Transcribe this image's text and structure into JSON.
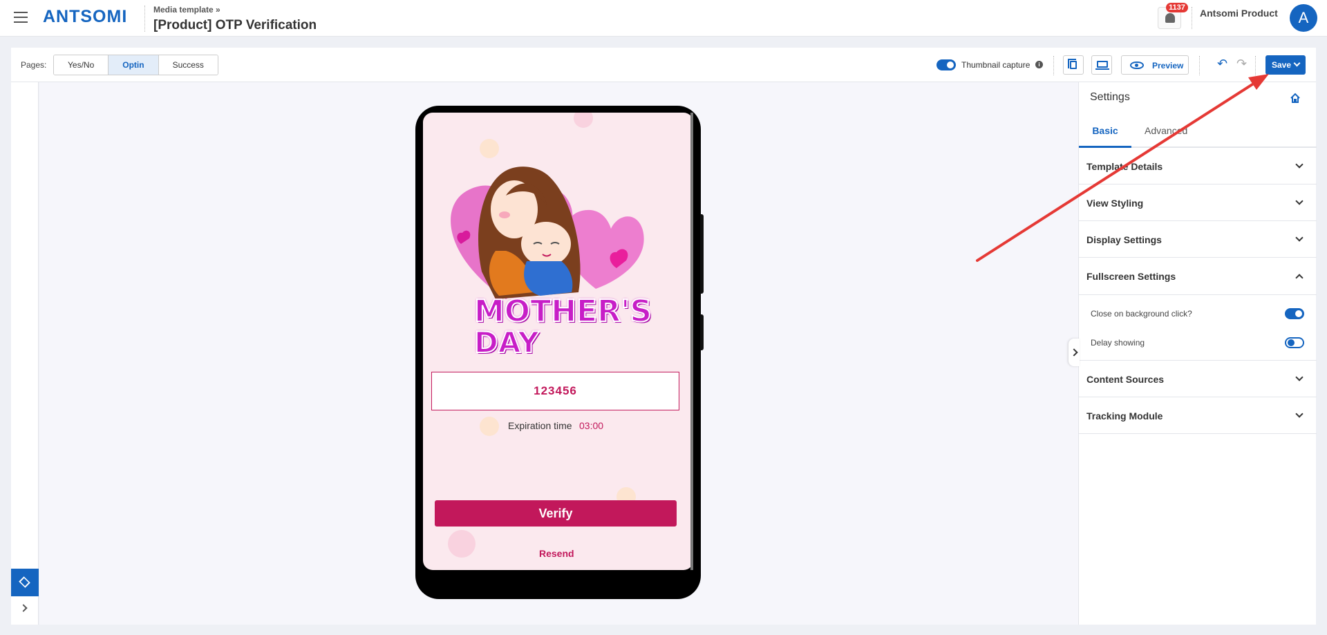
{
  "header": {
    "logo": "ANTSOMI",
    "breadcrumb": "Media template »",
    "title": "[Product] OTP Verification",
    "notification_count": "1137",
    "account_name": "Antsomi Product",
    "avatar_initial": "A"
  },
  "toolbar": {
    "pages_label": "Pages:",
    "pages": [
      {
        "label": "Yes/No",
        "active": false
      },
      {
        "label": "Optin",
        "active": true
      },
      {
        "label": "Success",
        "active": false
      }
    ],
    "thumbnail_capture_label": "Thumbnail capture",
    "thumbnail_capture_on": true,
    "preview_label": "Preview",
    "save_label": "Save"
  },
  "canvas": {
    "hero_line1": "MOTHER'S",
    "hero_line2": "DAY",
    "otp_value": "123456",
    "expiration_label": "Expiration time",
    "expiration_time": "03:00",
    "verify_label": "Verify",
    "resend_label": "Resend"
  },
  "settings": {
    "title": "Settings",
    "tabs": [
      {
        "label": "Basic",
        "active": true
      },
      {
        "label": "Advanced",
        "active": false
      }
    ],
    "sections": [
      {
        "label": "Template Details",
        "expanded": false
      },
      {
        "label": "View Styling",
        "expanded": false
      },
      {
        "label": "Display Settings",
        "expanded": false
      },
      {
        "label": "Fullscreen Settings",
        "expanded": true
      },
      {
        "label": "Content Sources",
        "expanded": false
      },
      {
        "label": "Tracking Module",
        "expanded": false
      }
    ],
    "fullscreen_options": [
      {
        "label": "Close on background click?",
        "on": true
      },
      {
        "label": "Delay showing",
        "on": false
      }
    ]
  },
  "colors": {
    "brand": "#1565c0",
    "accent": "#c2185b",
    "arrow": "#e53935"
  },
  "icons": [
    "hamburger-icon",
    "bell-icon",
    "info-icon",
    "copy-icon",
    "laptop-icon",
    "eye-icon",
    "undo-icon",
    "redo-icon",
    "chevron-down-icon",
    "layers-icon",
    "home-icon"
  ]
}
